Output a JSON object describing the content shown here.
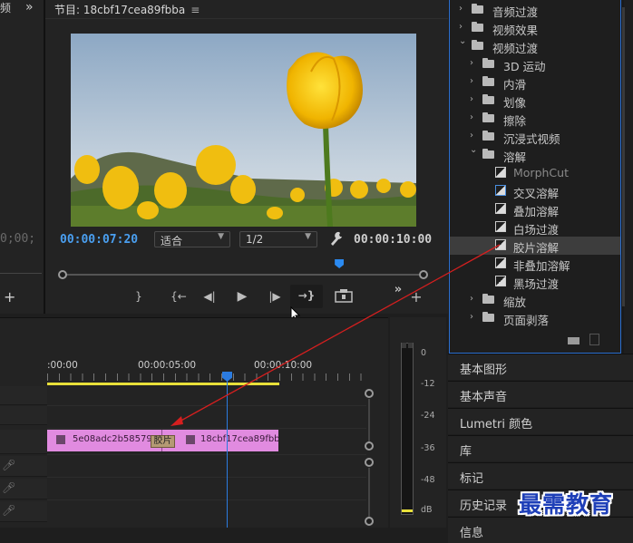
{
  "left_panel": {
    "top_fragment": "频",
    "timecode_fragment": "0;00;",
    "chevrons": "»",
    "add": "+"
  },
  "program": {
    "title": "节目: 18cbf17cea89fbba",
    "menu": "≡",
    "current_time": "00:00:07:20",
    "fit_value": "适合",
    "resolution_value": "1/2",
    "duration": "00:00:10:00",
    "playhead_fraction": 0.768,
    "controls": {
      "mark_in": "{",
      "mark_out": "}",
      "go_in": "{←",
      "step_back": "◀|",
      "play": "▶",
      "step_fwd": "|▶",
      "go_out": "→}",
      "export": "⛭",
      "more": "»",
      "add": "+"
    }
  },
  "timeline": {
    "ruler": [
      ":00:00",
      "00:00:05:00",
      "00:00:10:00"
    ],
    "clip1_label": "5e08adc2b5857959.j",
    "clip2_label": "18cbf17cea89fbba.jp",
    "transition_label": "胶片",
    "accent_clip": "#e18be0",
    "playhead_color": "#2b7be0"
  },
  "meter": {
    "labels": [
      "0",
      "-12",
      "-24",
      "-36",
      "-48",
      "dB"
    ]
  },
  "effects_tree": [
    {
      "level": 1,
      "open": false,
      "label": "音频过渡",
      "kind": "folder"
    },
    {
      "level": 1,
      "open": false,
      "label": "视频效果",
      "kind": "folder"
    },
    {
      "level": 1,
      "open": true,
      "label": "视频过渡",
      "kind": "folder"
    },
    {
      "level": 2,
      "open": false,
      "label": "3D 运动",
      "kind": "folder"
    },
    {
      "level": 2,
      "open": false,
      "label": "内滑",
      "kind": "folder"
    },
    {
      "level": 2,
      "open": false,
      "label": "划像",
      "kind": "folder"
    },
    {
      "level": 2,
      "open": false,
      "label": "擦除",
      "kind": "folder"
    },
    {
      "level": 2,
      "open": false,
      "label": "沉浸式视频",
      "kind": "folder"
    },
    {
      "level": 2,
      "open": true,
      "label": "溶解",
      "kind": "folder"
    },
    {
      "level": 3,
      "label": "MorphCut",
      "kind": "effect",
      "dim": true
    },
    {
      "level": 3,
      "label": "交叉溶解",
      "kind": "effect",
      "boxed": true
    },
    {
      "level": 3,
      "label": "叠加溶解",
      "kind": "effect"
    },
    {
      "level": 3,
      "label": "白场过渡",
      "kind": "effect"
    },
    {
      "level": 3,
      "label": "胶片溶解",
      "kind": "effect",
      "selected": true
    },
    {
      "level": 3,
      "label": "非叠加溶解",
      "kind": "effect"
    },
    {
      "level": 3,
      "label": "黑场过渡",
      "kind": "effect"
    },
    {
      "level": 2,
      "open": false,
      "label": "缩放",
      "kind": "folder"
    },
    {
      "level": 2,
      "open": false,
      "label": "页面剥落",
      "kind": "folder"
    }
  ],
  "sections": [
    "基本图形",
    "基本声音",
    "Lumetri 颜色",
    "库",
    "标记",
    "历史记录",
    "信息"
  ],
  "watermark": "最需教育",
  "colors": {
    "timecode_blue": "#4a9ff0",
    "timeline_yellow": "#e8e03a",
    "arrow_red": "#d61f1f",
    "watermark_blue": "#1e3fb8"
  }
}
